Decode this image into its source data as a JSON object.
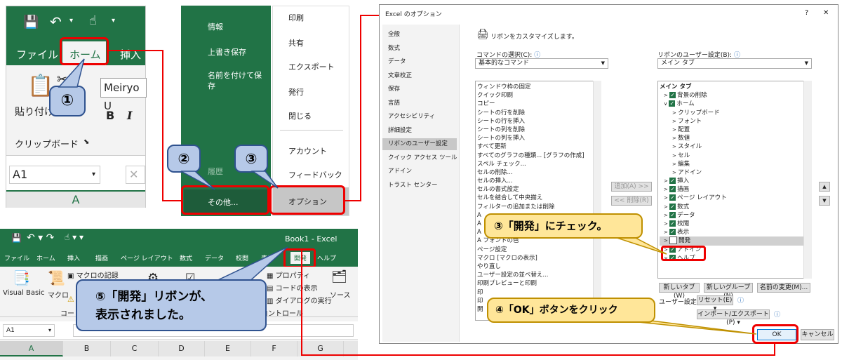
{
  "panel1": {
    "ribbon_tab_file": "ファイル",
    "ribbon_tab_home": "ホーム",
    "ribbon_tab_insert": "挿入",
    "paste_label": "貼り付け",
    "font_name": "Meiryo U",
    "clipboard_group": "クリップボード",
    "name_box": "A1",
    "column_a": "A",
    "bold": "B",
    "italic": "I",
    "cancel_x": "✕"
  },
  "panel2": {
    "info": "情報",
    "overwrite_save": "上書き保存",
    "save_as": "名前を付けて保存",
    "history": "履歴",
    "more": "その他..."
  },
  "panel3": {
    "print": "印刷",
    "share": "共有",
    "export": "エクスポート",
    "publish": "発行",
    "close": "閉じる",
    "account": "アカウント",
    "feedback": "フィードバック",
    "options": "オプション"
  },
  "options_dialog": {
    "title": "Excel のオプション",
    "help": "?",
    "close": "✕",
    "nav": [
      "全般",
      "数式",
      "データ",
      "文章校正",
      "保存",
      "言語",
      "アクセシビリティ",
      "詳細設定",
      "リボンのユーザー設定",
      "クイック アクセス ツール バー",
      "アドイン",
      "トラスト センター"
    ],
    "heading": "リボンをカスタマイズします。",
    "commands_label": "コマンドの選択(C):",
    "commands_value": "基本的なコマンド",
    "ribbon_label": "リボンのユーザー設定(B):",
    "ribbon_value": "メイン タブ",
    "commands_list": [
      "ウィンドウ枠の固定",
      "クイック印刷",
      "コピー",
      "シートの行を削除",
      "シートの行を挿入",
      "シートの列を削除",
      "シートの列を挿入",
      "すべて更新",
      "すべてのグラフの種類... [グラフの作成]",
      "スペル チェック...",
      "セルの削除...",
      "セルの挿入...",
      "セルの書式設定",
      "セルを結合して中央揃え",
      "フィルターの追加または削除",
      "A",
      "A",
      "A",
      "A フォントの色",
      "ページ設定",
      "マクロ [マクロの表示]",
      "やり直し",
      "ユーザー設定の並べ替え...",
      "印刷プレビューと印刷",
      "印",
      "印",
      "開"
    ],
    "add_button": "追加(A) >>",
    "remove_button": "<< 削除(R)",
    "tabs_tree": [
      {
        "label": "メイン タブ",
        "check": "none"
      },
      {
        "label": "背景の削除",
        "check": "on"
      },
      {
        "label": "ホーム",
        "check": "on"
      },
      {
        "label": "クリップボード",
        "check": "none"
      },
      {
        "label": "フォント",
        "check": "none"
      },
      {
        "label": "配置",
        "check": "none"
      },
      {
        "label": "数値",
        "check": "none"
      },
      {
        "label": "スタイル",
        "check": "none"
      },
      {
        "label": "セル",
        "check": "none"
      },
      {
        "label": "編集",
        "check": "none"
      },
      {
        "label": "アドイン",
        "check": "none"
      },
      {
        "label": "挿入",
        "check": "on"
      },
      {
        "label": "描画",
        "check": "on"
      },
      {
        "label": "ページ レイアウト",
        "check": "on"
      },
      {
        "label": "数式",
        "check": "on"
      },
      {
        "label": "データ",
        "check": "on"
      },
      {
        "label": "校閲",
        "check": "on"
      },
      {
        "label": "表示",
        "check": "on"
      },
      {
        "label": "開発",
        "check": "off"
      },
      {
        "label": "アドイン",
        "check": "on"
      },
      {
        "label": "ヘルプ",
        "check": "on"
      }
    ],
    "new_tab": "新しいタブ(W)",
    "new_group": "新しいグループ(N)",
    "rename": "名前の変更(M)...",
    "user_settings_label": "ユーザー設定:",
    "reset": "リセット(E) ▾",
    "import_export": "インポート/エクスポート(P) ▾",
    "ok": "OK",
    "cancel": "キャンセル"
  },
  "panel5": {
    "title": "Book1 - Excel",
    "tabs": [
      "ファイル",
      "ホーム",
      "挿入",
      "描画",
      "ページ レイアウト",
      "数式",
      "データ",
      "校閲",
      "表示",
      "開発",
      "ヘルプ"
    ],
    "visual_basic": "Visual Basic",
    "macro": "マクロ",
    "record_macro": "マクロの記録",
    "code_group": "コード",
    "properties": "プロパティ",
    "view_code": "コードの表示",
    "run_dialog": "ダイアログの実行",
    "control_group": "コントロール",
    "source": "ソース",
    "name_box": "A1",
    "columns": [
      "A",
      "B",
      "C",
      "D",
      "E",
      "F",
      "G"
    ]
  },
  "callouts": {
    "step1": "①",
    "step2": "②",
    "step3": "③",
    "step3_text": "③「開発」にチェック。",
    "step4_text": "④「OK」ボタンをクリック",
    "step5_text": "⑤「開発」リボンが、\n表示されました。"
  },
  "colors": {
    "excel_green": "#217346",
    "dark_green": "#1e5c3a",
    "callout_blue": "#b6c9e8",
    "callout_yellow": "#ffe699",
    "highlight_red": "#e00000"
  }
}
